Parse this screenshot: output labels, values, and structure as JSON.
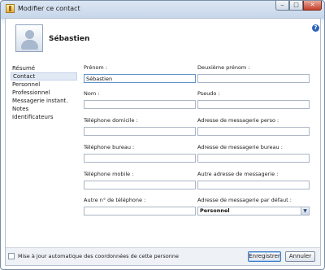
{
  "window": {
    "title": "Modifier ce contact"
  },
  "header": {
    "name": "Sébastien"
  },
  "nav": {
    "items": [
      {
        "label": "Résumé",
        "selected": false
      },
      {
        "label": "Contact",
        "selected": true
      },
      {
        "label": "Personnel",
        "selected": false
      },
      {
        "label": "Professionnel",
        "selected": false
      },
      {
        "label": "Messagerie instant.",
        "selected": false
      },
      {
        "label": "Notes",
        "selected": false
      },
      {
        "label": "Identificateurs",
        "selected": false
      }
    ]
  },
  "form": {
    "prenom": {
      "label": "Prénom :",
      "value": "Sébastien"
    },
    "deuxieme_prenom": {
      "label": "Deuxième prénom :",
      "value": ""
    },
    "nom": {
      "label": "Nom :",
      "value": ""
    },
    "pseudo": {
      "label": "Pseudo :",
      "value": ""
    },
    "tel_domicile": {
      "label": "Téléphone domicile :",
      "value": ""
    },
    "mail_perso": {
      "label": "Adresse de messagerie perso :",
      "value": ""
    },
    "tel_bureau": {
      "label": "Téléphone bureau :",
      "value": ""
    },
    "mail_bureau": {
      "label": "Adresse de messagerie bureau :",
      "value": ""
    },
    "tel_mobile": {
      "label": "Téléphone mobile :",
      "value": ""
    },
    "mail_autre": {
      "label": "Autre adresse de messagerie :",
      "value": ""
    },
    "tel_autre": {
      "label": "Autre n° de téléphone :",
      "value": ""
    },
    "mail_defaut": {
      "label": "Adresse de messagerie par défaut :",
      "selected": "Personnel"
    }
  },
  "footer": {
    "auto_update_label": "Mise à jour automatique des coordonnées de cette personne",
    "auto_update_checked": false,
    "save_label": "Enregistrer",
    "cancel_label": "Annuler"
  }
}
